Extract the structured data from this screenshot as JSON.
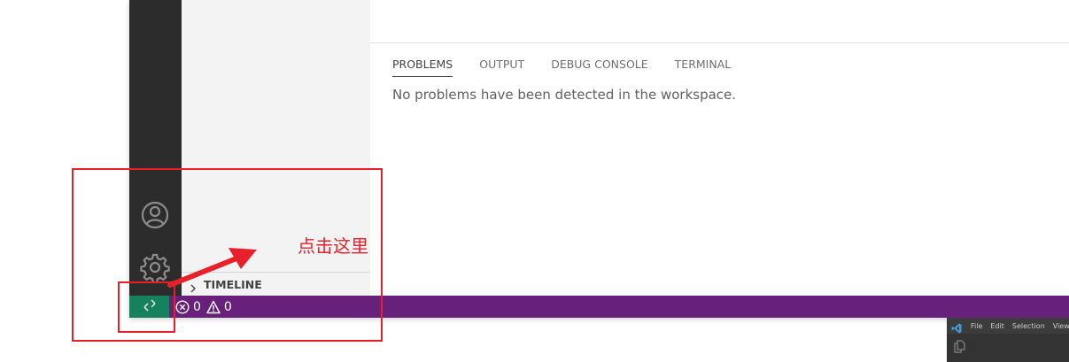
{
  "panel": {
    "tabs": [
      {
        "label": "PROBLEMS",
        "active": true
      },
      {
        "label": "OUTPUT",
        "active": false
      },
      {
        "label": "DEBUG CONSOLE",
        "active": false
      },
      {
        "label": "TERMINAL",
        "active": false
      }
    ],
    "message": "No problems have been detected in the workspace."
  },
  "sidebar": {
    "timeline_label": "TIMELINE"
  },
  "statusbar": {
    "errors": "0",
    "warnings": "0",
    "remote_icon": "remote-icon",
    "colors": {
      "background": "#68217a",
      "remote_background": "#16825d"
    }
  },
  "annotation": {
    "text": "点击这里",
    "color": "#e8202a"
  },
  "mini_window": {
    "menu": [
      "File",
      "Edit",
      "Selection",
      "View"
    ]
  }
}
